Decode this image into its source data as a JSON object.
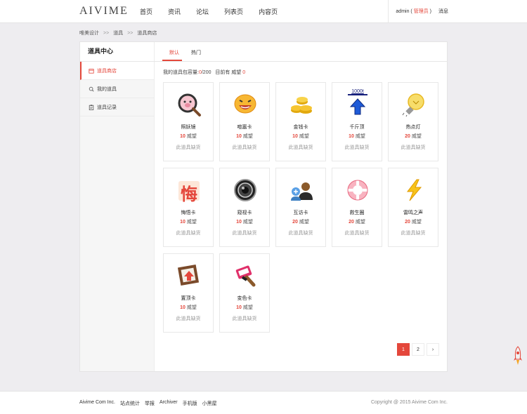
{
  "header": {
    "logo": "AIVIME",
    "nav": [
      "首页",
      "资讯",
      "论坛",
      "列表页",
      "内容页"
    ],
    "user": "admin",
    "role_open": " ( ",
    "role": "管理员",
    "role_close": " )",
    "messages": "消息"
  },
  "breadcrumb": [
    "唯美设计",
    "道具",
    "道具商店"
  ],
  "breadcrumb_sep": ">>",
  "sidebar": {
    "title": "道具中心",
    "items": [
      {
        "label": "道具商店",
        "icon": "shop-icon",
        "active": true
      },
      {
        "label": "我的道具",
        "icon": "magnifier-icon",
        "active": false
      },
      {
        "label": "道具记录",
        "icon": "clipboard-icon",
        "active": false
      }
    ]
  },
  "tabs": [
    {
      "label": "默认",
      "active": true
    },
    {
      "label": "热门",
      "active": false
    }
  ],
  "capacity": {
    "label": "我的道具包容量:",
    "current": "0",
    "max": "/200",
    "prestige_label": "目前有 威望",
    "prestige": "0"
  },
  "items": [
    {
      "name": "照妖镜",
      "price": "10",
      "unit": " 威望",
      "status": "此道具缺货",
      "icon": "magnifier-pig-icon"
    },
    {
      "name": "喧嚣卡",
      "price": "10",
      "unit": " 威望",
      "status": "此道具缺货",
      "icon": "laughing-face-icon"
    },
    {
      "name": "金钱卡",
      "price": "10",
      "unit": " 威望",
      "status": "此道具缺货",
      "icon": "gold-coins-icon"
    },
    {
      "name": "千斤顶",
      "price": "10",
      "unit": " 威望",
      "status": "此道具缺货",
      "icon": "weight-arrow-icon",
      "label": "1000t"
    },
    {
      "name": "热点灯",
      "price": "20",
      "unit": " 威望",
      "status": "此道具缺货",
      "icon": "light-bulb-icon"
    },
    {
      "name": "悔悟卡",
      "price": "10",
      "unit": " 威望",
      "status": "此道具缺货",
      "icon": "regret-character-icon",
      "label": "悔"
    },
    {
      "name": "窥视卡",
      "price": "10",
      "unit": " 威望",
      "status": "此道具缺货",
      "icon": "camera-lens-icon"
    },
    {
      "name": "互访卡",
      "price": "20",
      "unit": " 威望",
      "status": "此道具缺货",
      "icon": "two-users-icon"
    },
    {
      "name": "救生圈",
      "price": "20",
      "unit": " 威望",
      "status": "此道具缺货",
      "icon": "life-ring-icon"
    },
    {
      "name": "雷鸣之声",
      "price": "20",
      "unit": " 威望",
      "status": "此道具缺货",
      "icon": "lightning-icon"
    },
    {
      "name": "置顶卡",
      "price": "10",
      "unit": " 威望",
      "status": "此道具缺货",
      "icon": "up-arrow-frame-icon"
    },
    {
      "name": "变色卡",
      "price": "10",
      "unit": " 威望",
      "status": "此道具缺货",
      "icon": "paint-brush-icon"
    }
  ],
  "pagination": {
    "pages": [
      "1",
      "2"
    ],
    "current": "1",
    "next": "›"
  },
  "footer": {
    "links": [
      "Aivime Com Inc.",
      "站点统计",
      "举报",
      "Archiver",
      "手机版",
      "小黑屋"
    ],
    "copyright": "Copyright @ 2015 Aivime Com Inc."
  },
  "colors": {
    "accent": "#e4473b",
    "background": "#eeedf0"
  }
}
